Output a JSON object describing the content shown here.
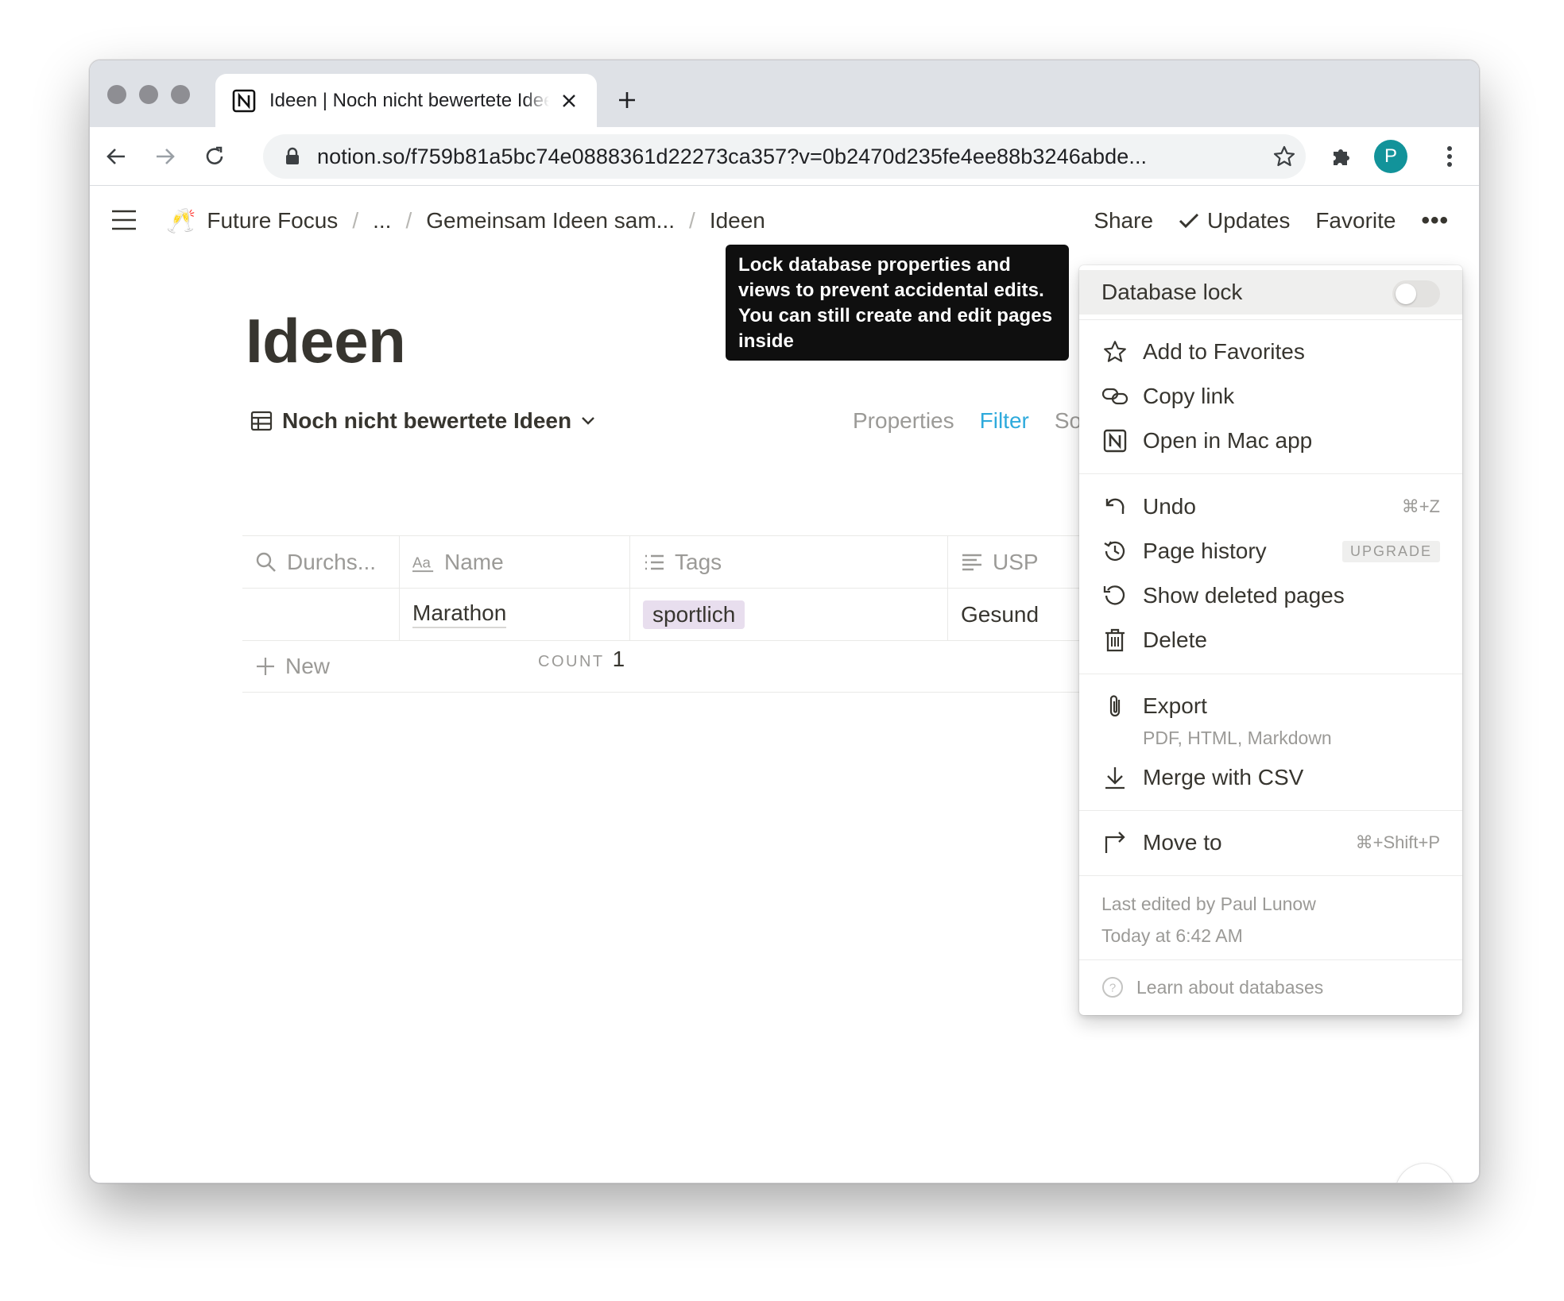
{
  "browser": {
    "tab_title": "Ideen | Noch nicht bewertete Ideen",
    "url": "notion.so/f759b81a5bc74e0888361d22273ca357?v=0b2470d235fe4ee88b3246abde...",
    "profile_initial": "P",
    "avatar_color": "#12939a"
  },
  "breadcrumbs": {
    "workspace_emoji": "🥂",
    "items": [
      "Future Focus",
      "...",
      "Gemeinsam Ideen sam...",
      "Ideen"
    ],
    "separator": "/"
  },
  "top_actions": {
    "share": "Share",
    "updates": "Updates",
    "favorite": "Favorite",
    "more": "•••"
  },
  "page": {
    "title": "Ideen"
  },
  "view": {
    "name": "Noch nicht bewertete Ideen",
    "options": {
      "properties": "Properties",
      "filter": "Filter",
      "sort": "Sort"
    },
    "filter_color": "#2eaadc"
  },
  "table": {
    "columns": [
      {
        "label": "Durchs...",
        "icon": "search-icon"
      },
      {
        "label": "Name",
        "icon": "title-aa-icon"
      },
      {
        "label": "Tags",
        "icon": "list-icon"
      },
      {
        "label": "USP",
        "icon": "text-lines-icon"
      }
    ],
    "rows": [
      {
        "durchs": "",
        "name": "Marathon",
        "tags": "sportlich",
        "usp": "Gesund"
      }
    ],
    "new_label": "New",
    "tag_color": "#e8deee",
    "count_label": "COUNT",
    "count_value": "1"
  },
  "tooltip": {
    "text": "Lock database properties and views to prevent accidental edits. You can still create and edit pages inside"
  },
  "menu": {
    "database_lock": "Database lock",
    "add_favorites": "Add to Favorites",
    "copy_link": "Copy link",
    "open_mac": "Open in Mac app",
    "undo": "Undo",
    "undo_shortcut": "⌘+Z",
    "page_history": "Page history",
    "upgrade_badge": "UPGRADE",
    "show_deleted": "Show deleted pages",
    "delete": "Delete",
    "export": "Export",
    "export_sub": "PDF, HTML, Markdown",
    "merge_csv": "Merge with CSV",
    "move_to": "Move to",
    "move_shortcut": "⌘+Shift+P",
    "last_edited": "Last edited by Paul Lunow",
    "edited_time": "Today at 6:42 AM",
    "learn": "Learn about databases"
  },
  "help": {
    "label": "?"
  }
}
